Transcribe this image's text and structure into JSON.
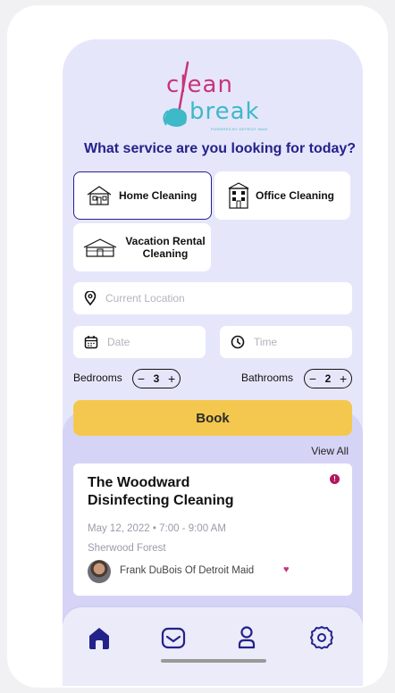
{
  "logo": {
    "word1": "clean",
    "word2": "break",
    "sub": "POWERED BY DETROIT MAID"
  },
  "heading": "What service are you looking for today?",
  "services": [
    {
      "label": "Home Cleaning",
      "icon": "house-icon",
      "selected": true
    },
    {
      "label": "Office Cleaning",
      "icon": "office-building-icon",
      "selected": false
    },
    {
      "label": "Vacation Rental Cleaning",
      "icon": "vacation-house-icon",
      "selected": false
    }
  ],
  "location": {
    "placeholder": "Current Location"
  },
  "date": {
    "placeholder": "Date"
  },
  "time": {
    "placeholder": "Time"
  },
  "bedrooms": {
    "label": "Bedrooms",
    "value": "3"
  },
  "bathrooms": {
    "label": "Bathrooms",
    "value": "2"
  },
  "book_label": "Book",
  "view_all": "View All",
  "booking": {
    "title_line1": "The Woodward",
    "title_line2": "Disinfecting Cleaning",
    "date": "May 12, 2022 • 7:00 - 9:00 AM",
    "location": "Sherwood Forest",
    "cleaner": "Frank DuBois Of Detroit Maid"
  },
  "colors": {
    "accent": "#23228a",
    "book": "#f4c84e",
    "pink": "#c8347a",
    "teal": "#3db9c7"
  }
}
